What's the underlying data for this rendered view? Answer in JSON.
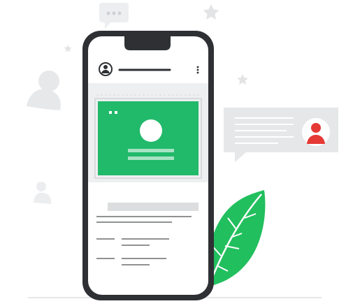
{
  "illustration": {
    "colors": {
      "accent_green": "#21B96A",
      "leaf_green": "#23C05F",
      "alert_red": "#E53935",
      "outline_dark": "#2D2F33",
      "card_gray": "#E6E7E9",
      "decor_gray": "#E9EAEC",
      "line_gray": "#4D4F52",
      "placeholder_gray": "#DCDDDF"
    },
    "icons": [
      "smartphone",
      "user-avatar-icon",
      "kebab-menu-icon",
      "image-placeholder",
      "chat-bubble-icon",
      "message-card",
      "person-icon",
      "star-icon",
      "leaf"
    ]
  }
}
